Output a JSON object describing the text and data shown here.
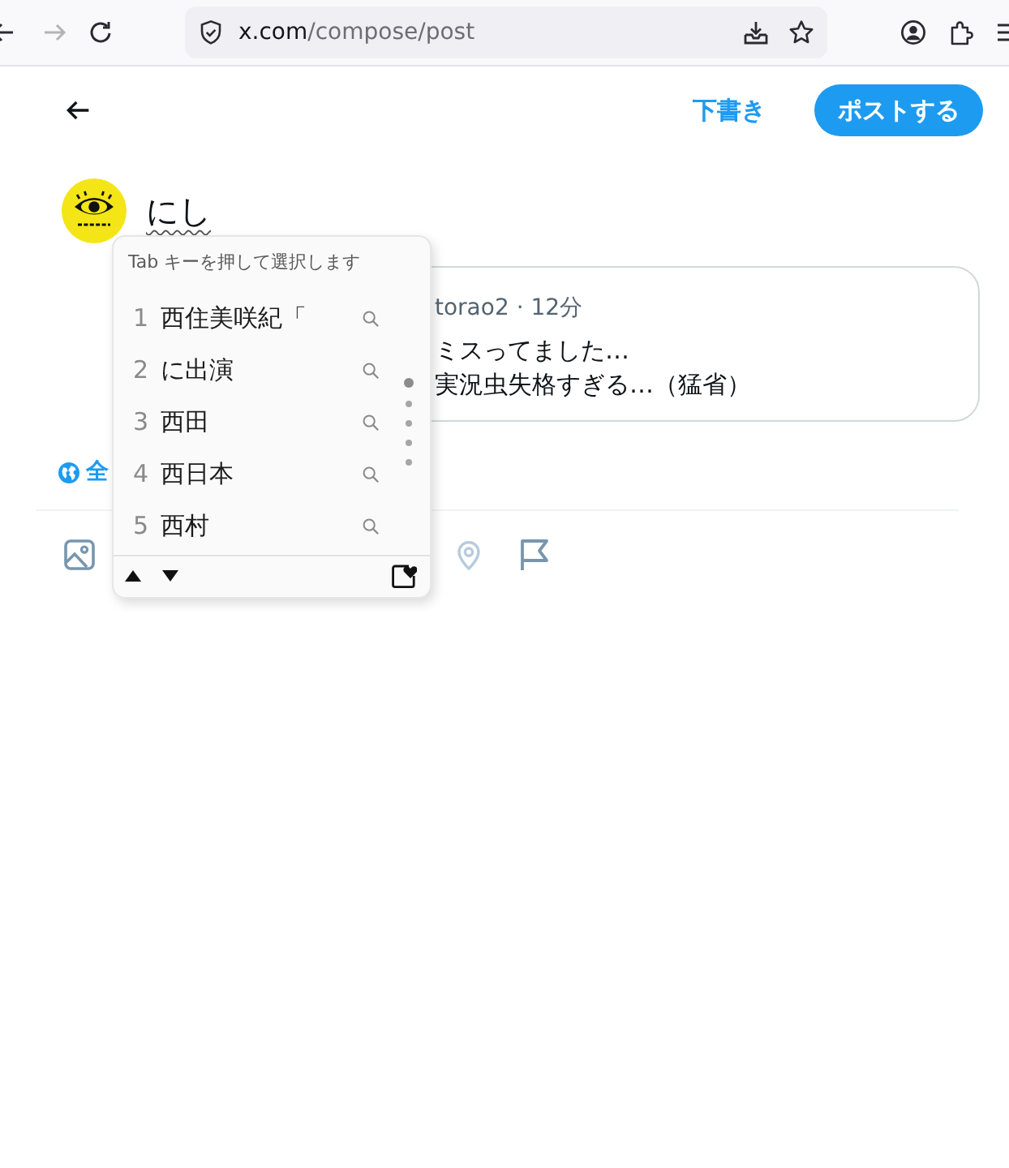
{
  "browser": {
    "nav": [
      {
        "kind": "back",
        "disabled": false
      },
      {
        "kind": "forward",
        "disabled": true
      },
      {
        "kind": "reload",
        "disabled": false
      }
    ],
    "url_host": "x.com",
    "url_path": "/compose/post"
  },
  "header": {
    "draft_button": "下書き",
    "post_button": "ポストする"
  },
  "composer": {
    "text": "にし",
    "composing": true
  },
  "quote": {
    "meta": "torao2 · 12分",
    "lines": [
      "ミスってました…",
      "実況虫失格すぎる…（猛省）"
    ]
  },
  "reply_setting": {
    "label": "全"
  },
  "toolbar": [
    {
      "kind": "image",
      "disabled": false
    },
    {
      "kind": "location",
      "disabled": true
    },
    {
      "kind": "flag",
      "disabled": false
    }
  ],
  "ime": {
    "hint": "Tab キーを押して選択します",
    "candidates": [
      {
        "number": "1",
        "text": "西住美咲紀「",
        "selected": false
      },
      {
        "number": "2",
        "text": "に出演",
        "selected": false
      },
      {
        "number": "3",
        "text": "西田",
        "selected": false
      },
      {
        "number": "4",
        "text": "西日本",
        "selected": false
      },
      {
        "number": "5",
        "text": "西村",
        "selected": false
      }
    ],
    "pages": [
      {
        "selected": true
      },
      {
        "selected": false
      },
      {
        "selected": false
      },
      {
        "selected": false
      },
      {
        "selected": false
      }
    ]
  }
}
